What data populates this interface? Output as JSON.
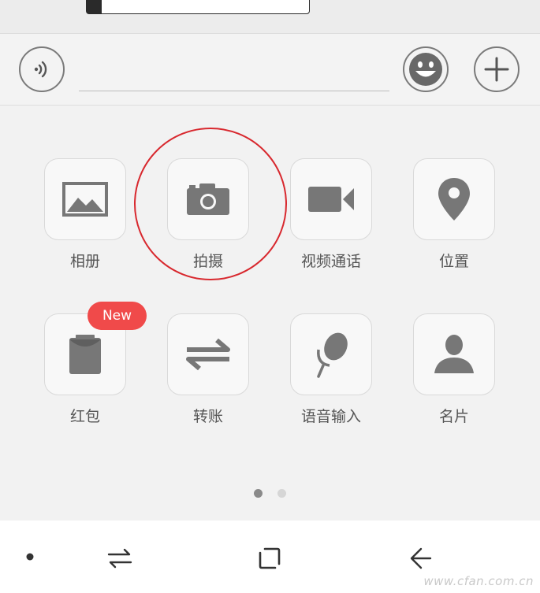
{
  "colors": {
    "icon": "#777777",
    "accent_red": "#f04a4a",
    "ring_red": "#d8282e"
  },
  "input_bar": {
    "voice_icon": "voice-wave-icon",
    "emoji_icon": "smiley-icon",
    "plus_icon": "plus-icon"
  },
  "grid": {
    "items": [
      {
        "label": "相册",
        "icon": "image-icon"
      },
      {
        "label": "拍摄",
        "icon": "camera-icon"
      },
      {
        "label": "视频通话",
        "icon": "video-camera-icon"
      },
      {
        "label": "位置",
        "icon": "location-pin-icon"
      },
      {
        "label": "红包",
        "icon": "red-envelope-icon",
        "badge": "New"
      },
      {
        "label": "转账",
        "icon": "transfer-arrows-icon"
      },
      {
        "label": "语音输入",
        "icon": "microphone-icon"
      },
      {
        "label": "名片",
        "icon": "person-icon"
      }
    ]
  },
  "pager": {
    "current_page": 1,
    "total_pages": 2
  },
  "nav_bar": {
    "buttons": [
      "dot-icon",
      "switch-arrows-icon",
      "home-square-icon",
      "back-arrow-icon"
    ]
  },
  "watermark": "www.cfan.com.cn"
}
